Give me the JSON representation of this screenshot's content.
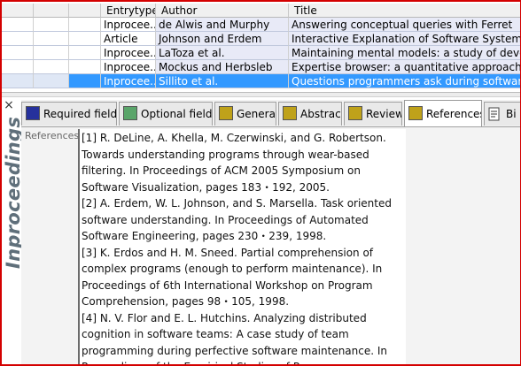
{
  "table": {
    "columns": {
      "entrytype": "Entrytype",
      "author": "Author",
      "title": "Title"
    },
    "rows": [
      {
        "entrytype": "Inprocee...",
        "author": "de Alwis and Murphy",
        "title": "Answering conceptual queries with Ferret",
        "selected": false
      },
      {
        "entrytype": "Article",
        "author": "Johnson and Erdem",
        "title": "Interactive Explanation of Software Systems",
        "selected": false
      },
      {
        "entrytype": "Inprocee...",
        "author": "LaToza et al.",
        "title": "Maintaining mental models: a study of develope",
        "selected": false
      },
      {
        "entrytype": "Inprocee...",
        "author": "Mockus and Herbsleb",
        "title": "Expertise browser: a quantitative approach to ide",
        "selected": false
      },
      {
        "entrytype": "Inprocee...",
        "author": "Sillito et al.",
        "title": "Questions programmers ask during software ev",
        "selected": true
      }
    ]
  },
  "editor": {
    "close": "×",
    "entry_type_title": "Inproceedings",
    "tabs": [
      {
        "label": "Required fields",
        "icon": "square-icon-blue",
        "color": "#26319c"
      },
      {
        "label": "Optional fields",
        "icon": "square-icon-green",
        "color": "#5aa56a"
      },
      {
        "label": "General",
        "icon": "square-icon-olive",
        "color": "#bfa21a"
      },
      {
        "label": "Abstract",
        "icon": "square-icon-olive",
        "color": "#bfa21a"
      },
      {
        "label": "Review",
        "icon": "square-icon-olive",
        "color": "#bfa21a"
      },
      {
        "label": "References",
        "icon": "square-icon-olive",
        "color": "#bfa21a",
        "active": true
      },
      {
        "label": "Bi",
        "icon": "bibtex-source-icon"
      }
    ],
    "field_label": "References",
    "references_lines": [
      "[1] R. DeLine, A. Khella, M. Czerwinski, and G. Robertson.",
      "Towards understanding programs through wear-based",
      "filtering. In Proceedings of ACM 2005 Symposium on",
      "Software Visualization, pages 183・192, 2005.",
      "[2] A. Erdem, W. L. Johnson, and S. Marsella. Task oriented",
      "software understanding. In Proceedings of Automated",
      "Software Engineering, pages 230・239, 1998.",
      "[3] K. Erdos and H. M. Sneed. Partial comprehension of",
      "complex programs (enough to perform maintenance). In",
      "Proceedings of 6th International Workshop on Program",
      "Comprehension, pages 98・105, 1998.",
      "[4] N. V. Flor and E. L. Hutchins. Analyzing distributed",
      "cognition in software teams: A case study of team",
      "programming during perfective software maintenance. In",
      "Proceedings of the Empirical Studies of Programmers:"
    ]
  },
  "colors": {
    "selection": "#3399ff",
    "row_highlight": "#e8eaf7",
    "frame_border": "#d40000"
  }
}
